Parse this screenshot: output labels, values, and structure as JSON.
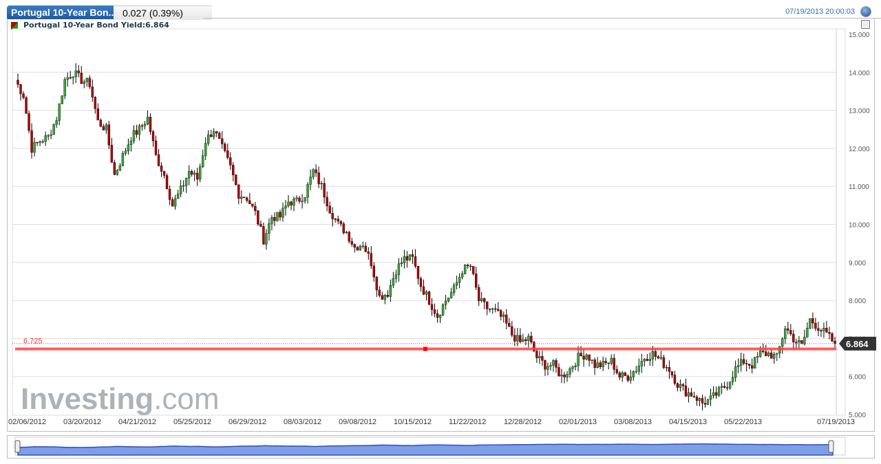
{
  "header": {
    "tab_label": "Portugal 10-Year Bon...",
    "change": "0.027 (0.39%)",
    "timestamp": "07/19/2013 20:00:03"
  },
  "legend": {
    "text": "Portugal 10-Year Bond Yield:6.864"
  },
  "brand": {
    "logo_main": "Investing",
    "logo_suffix": ".com"
  },
  "colors": {
    "up": "#3aa83a",
    "down": "#b00000",
    "line": "#ff4040",
    "nav": "#7e9ee8"
  },
  "chart_data": {
    "type": "candlestick",
    "title": "Portugal 10-Year Bond Yield",
    "ylim": [
      5,
      15
    ],
    "yticks": [
      "15.000",
      "14.000",
      "13.000",
      "12.000",
      "11.000",
      "10.000",
      "9.000",
      "8.000",
      "7.000",
      "6.000",
      "5.000"
    ],
    "xticks": [
      "02/06/2012",
      "03/20/2012",
      "04/21/2012",
      "05/25/2012",
      "06/29/2012",
      "08/03/2012",
      "09/08/2012",
      "10/15/2012",
      "11/22/2012",
      "12/28/2012",
      "02/01/2013",
      "03/08/2013",
      "04/15/2013",
      "05/22/2013",
      "07/19/2013"
    ],
    "last_value": "6.864",
    "hline_value": 6.725,
    "hline_label": "6.725",
    "closes": [
      13.8,
      13.4,
      12.0,
      12.2,
      12.3,
      12.8,
      13.8,
      14.0,
      13.8,
      13.7,
      12.7,
      12.5,
      11.3,
      11.8,
      12.3,
      12.5,
      12.8,
      11.8,
      11.3,
      10.5,
      10.9,
      11.4,
      11.2,
      12.2,
      12.5,
      12.0,
      11.5,
      10.8,
      10.7,
      10.3,
      9.6,
      10.2,
      10.2,
      10.6,
      10.6,
      10.8,
      11.4,
      11.0,
      10.4,
      10.0,
      9.8,
      9.4,
      9.5,
      9.0,
      8.1,
      8.2,
      8.8,
      9.1,
      9.1,
      8.4,
      8.0,
      7.6,
      8.0,
      8.3,
      8.8,
      8.9,
      8.0,
      7.8,
      7.7,
      7.5,
      7.1,
      6.9,
      7.0,
      6.5,
      6.3,
      6.3,
      6.0,
      6.2,
      6.5,
      6.6,
      6.3,
      6.3,
      6.4,
      6.0,
      6.0,
      6.2,
      6.5,
      6.6,
      6.4,
      6.2,
      5.8,
      5.6,
      5.5,
      5.3,
      5.4,
      5.6,
      5.8,
      6.2,
      6.4,
      6.3,
      6.6,
      6.6,
      6.5,
      7.3,
      7.0,
      6.8,
      7.5,
      7.3,
      7.1,
      6.864
    ]
  }
}
